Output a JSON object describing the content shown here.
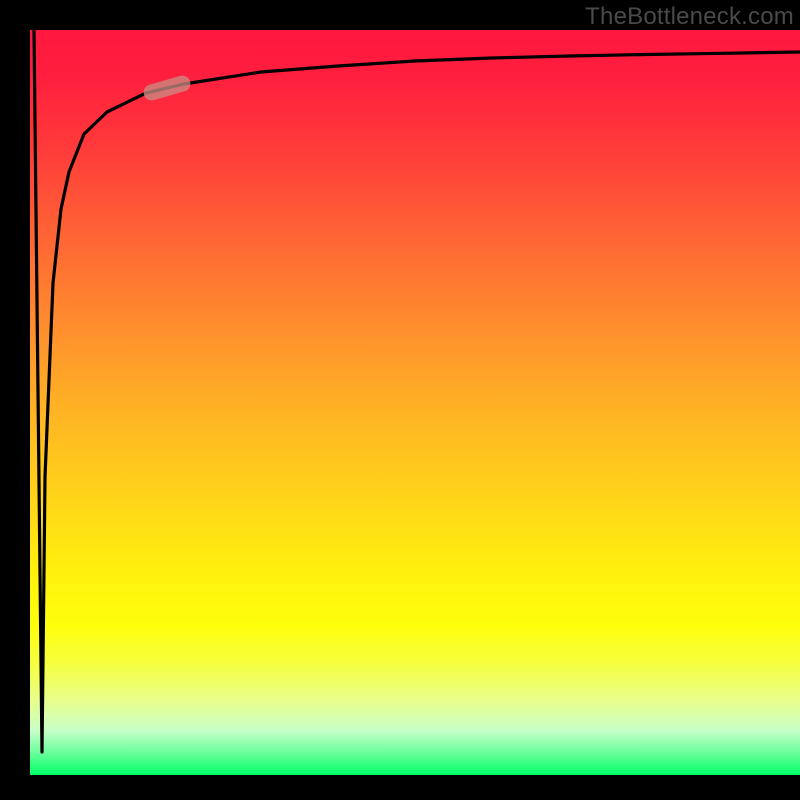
{
  "attribution": "TheBottleneck.com",
  "colors": {
    "page_bg": "#000000",
    "curve_stroke": "#000000",
    "marker_fill": "#c98e85",
    "marker_opacity": 0.75,
    "attribution_text": "#4a4a4a"
  },
  "chart_data": {
    "type": "line",
    "title": "",
    "xlabel": "",
    "ylabel": "",
    "xlim": [
      0,
      100
    ],
    "ylim": [
      0,
      100
    ],
    "grid": false,
    "legend": false,
    "background_gradient": [
      {
        "pos": 0,
        "color": "#ff173f"
      },
      {
        "pos": 50,
        "color": "#ffb025"
      },
      {
        "pos": 80,
        "color": "#fdff0b"
      },
      {
        "pos": 100,
        "color": "#00ff66"
      }
    ],
    "series": [
      {
        "name": "down-stroke",
        "x": [
          0.5,
          1.5
        ],
        "y": [
          100,
          3
        ]
      },
      {
        "name": "log-curve",
        "x": [
          1.5,
          2,
          3,
          4,
          5,
          7,
          10,
          15,
          20,
          30,
          40,
          50,
          60,
          70,
          80,
          90,
          100
        ],
        "y": [
          3,
          40,
          66,
          76,
          81,
          86,
          89,
          91.5,
          92.8,
          94.3,
          95.2,
          95.8,
          96.2,
          96.5,
          96.7,
          96.9,
          97.1
        ]
      }
    ],
    "marker": {
      "x": 18,
      "y": 92,
      "shape": "rounded-pill"
    }
  }
}
